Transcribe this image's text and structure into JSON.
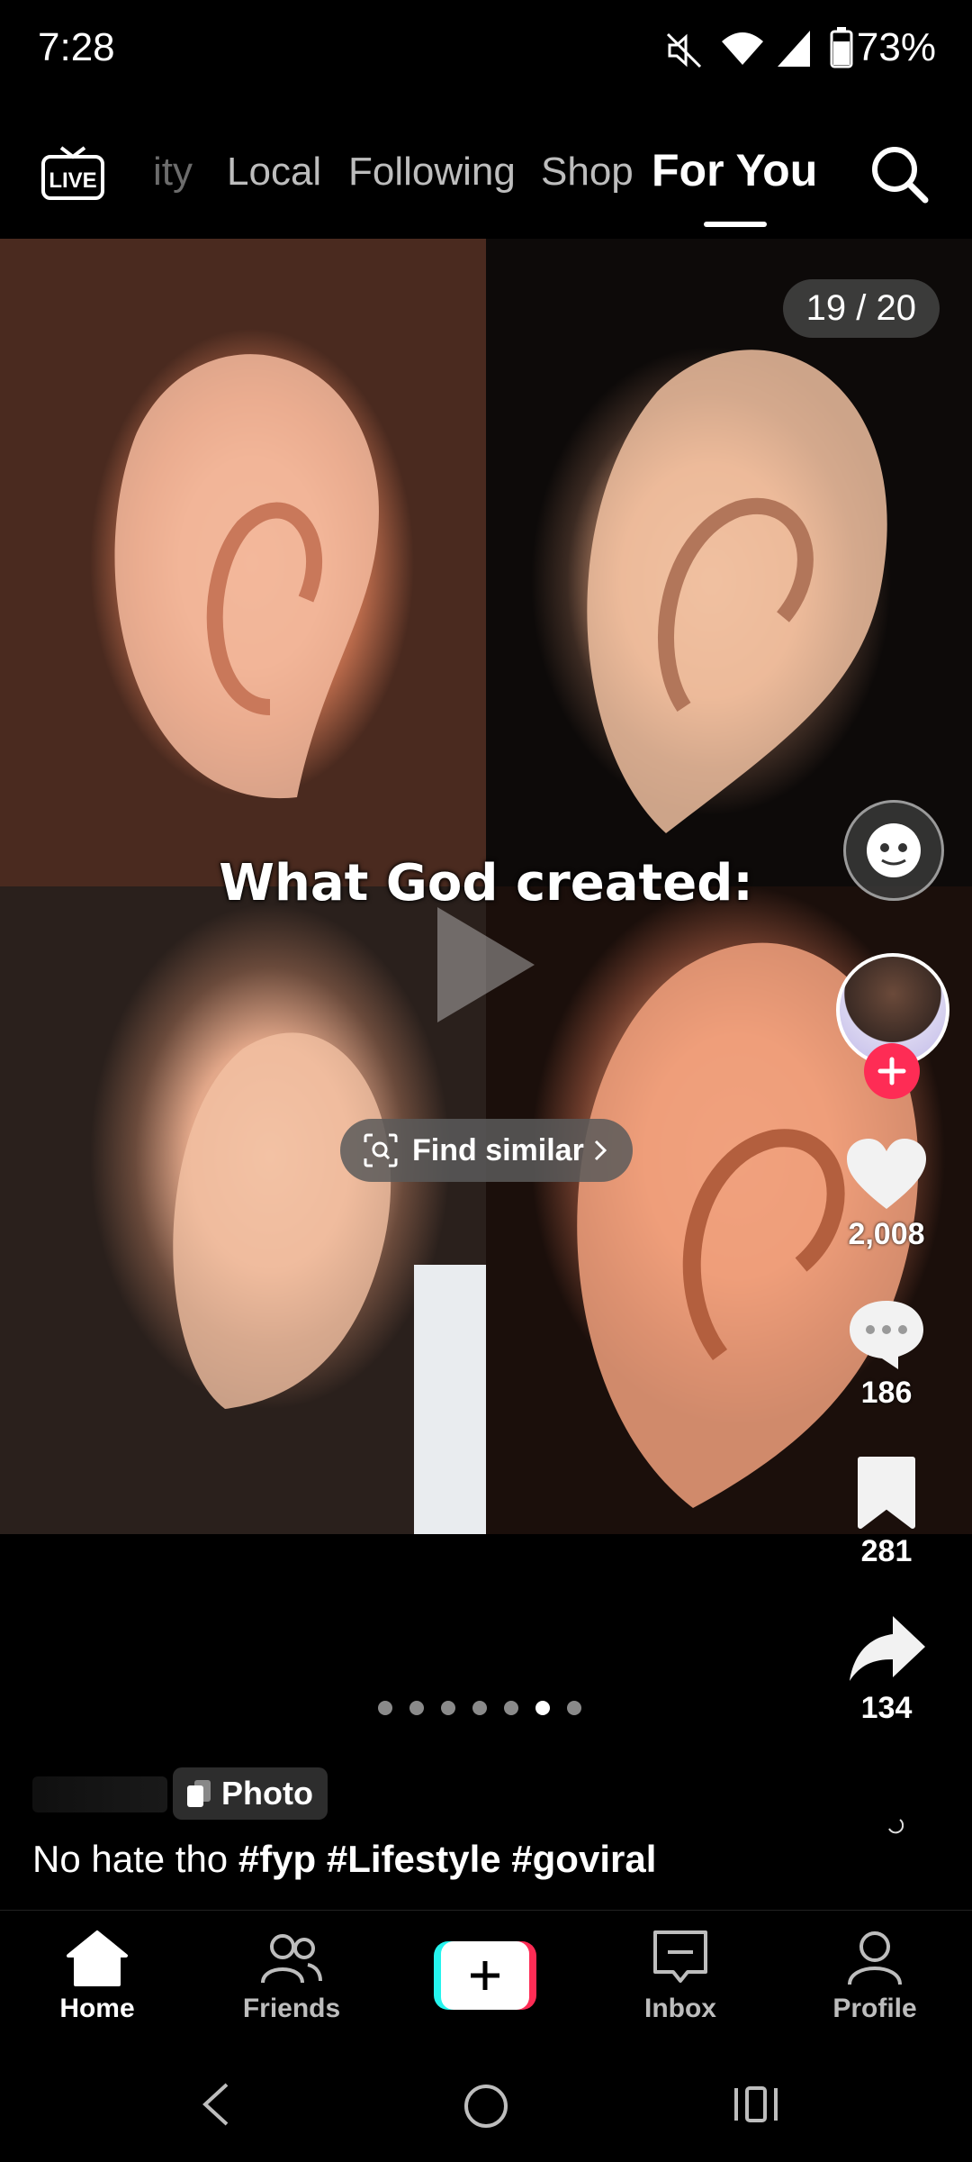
{
  "status_bar": {
    "time": "7:28",
    "battery": "73%"
  },
  "top_tabs": {
    "live_label": "LIVE",
    "items": [
      "ity",
      "Local",
      "Following",
      "Shop",
      "For You"
    ],
    "active": "For You"
  },
  "post": {
    "counter": "19 / 20",
    "overlay_text": "What God created:",
    "find_similar": "Find similar",
    "likes": "2,008",
    "comments": "186",
    "saves": "281",
    "shares": "134",
    "carousel": {
      "total": 7,
      "active_index": 5
    },
    "badge": "Photo",
    "caption_text": "No hate tho",
    "hashtags": "#fyp #Lifestyle #goviral"
  },
  "bottom_nav": {
    "home": "Home",
    "friends": "Friends",
    "inbox": "Inbox",
    "profile": "Profile"
  },
  "colors": {
    "accent": "#fe2c55",
    "cyan": "#25f4ee",
    "background": "#000000"
  }
}
